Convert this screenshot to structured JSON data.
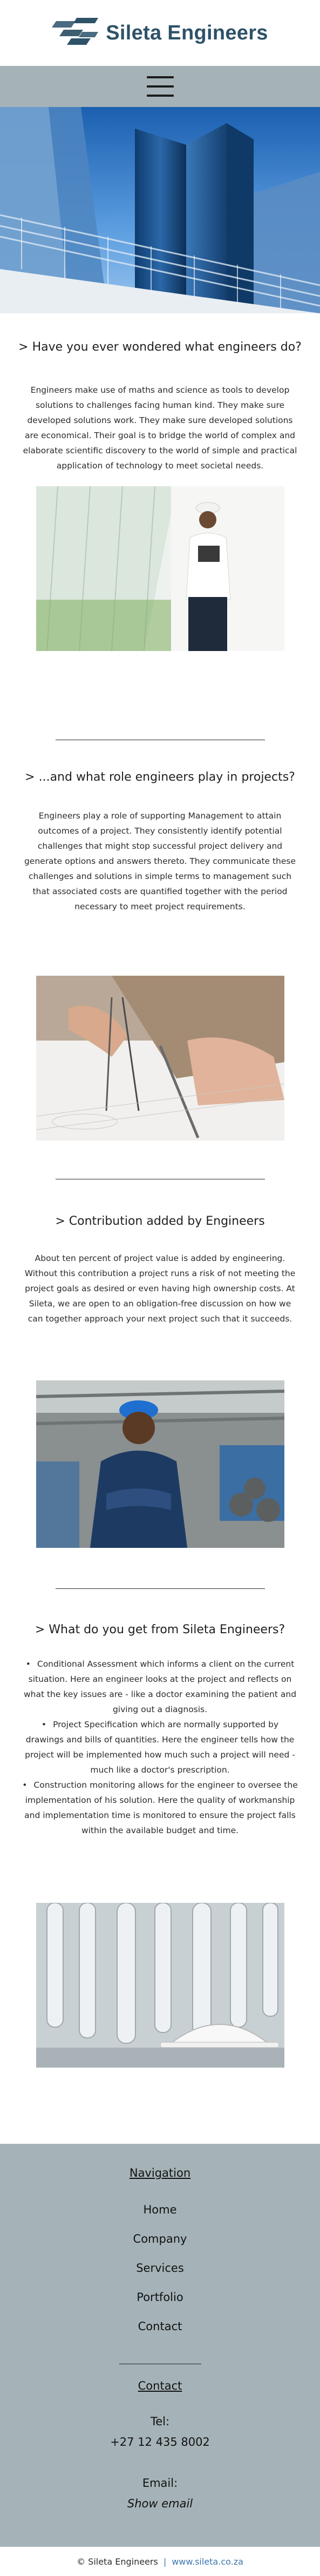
{
  "header": {
    "logo_text": "Sileta Engineers",
    "brand_color": "#2e5268",
    "menu_icon": "hamburger-menu-icon"
  },
  "sections": [
    {
      "title": "> Have you ever wondered what engineers do?",
      "body": "Engineers make use of maths and science as tools to develop solutions to challenges facing human kind. They make sure developed solutions work. They make sure developed solutions are economical. Their goal is to bridge the world of complex and elaborate scientific discovery to the world of simple and practical application of technology to meet societal needs."
    },
    {
      "title": "> ...and what role engineers play in projects?",
      "body": "Engineers play a role of supporting Management to attain outcomes of a project. They consistently identify potential challenges that might stop successful project delivery and generate options and answers thereto. They communicate these challenges and solutions in simple terms to management such that associated costs are quantified together with the period necessary to meet project requirements."
    },
    {
      "title": "> Contribution added by Engineers",
      "body": "About ten percent of project value is added by engineering. Without this contribution a project runs a risk of not meeting the project goals as desired or even having high ownership costs. At Sileta, we are open to an obligation-free discussion on how we can together approach your next project such that it succeeds."
    },
    {
      "title": "> What do you get from Sileta Engineers?",
      "items": [
        "Conditional Assessment which informs a client on the current situation. Here an engineer looks at the project and reflects on what the key issues are - like a doctor examining the patient and giving out a diagnosis.",
        "Project Specification which are normally supported by drawings and bills of quantities. Here the engineer tells how the project will be implemented how much such a project will need - much like a doctor's prescription.",
        "Construction monitoring allows for the engineer to oversee the implementation of his solution. Here the quality of workmanship and implementation time is monitored to ensure the project falls within the available budget and time."
      ]
    }
  ],
  "footer": {
    "nav_heading": "Navigation",
    "nav_links": [
      "Home",
      "Company",
      "Services",
      "Portfolio",
      "Contact"
    ],
    "contact_heading": "Contact",
    "tel_label": "Tel:",
    "tel_value": "+27 12 435 8002",
    "email_label": "Email:",
    "email_value": "Show email",
    "copyright": "© Sileta Engineers",
    "separator": "|",
    "website": "www.sileta.co.za",
    "link_color": "#3b76b0",
    "bg_color": "#a5b3b8"
  }
}
